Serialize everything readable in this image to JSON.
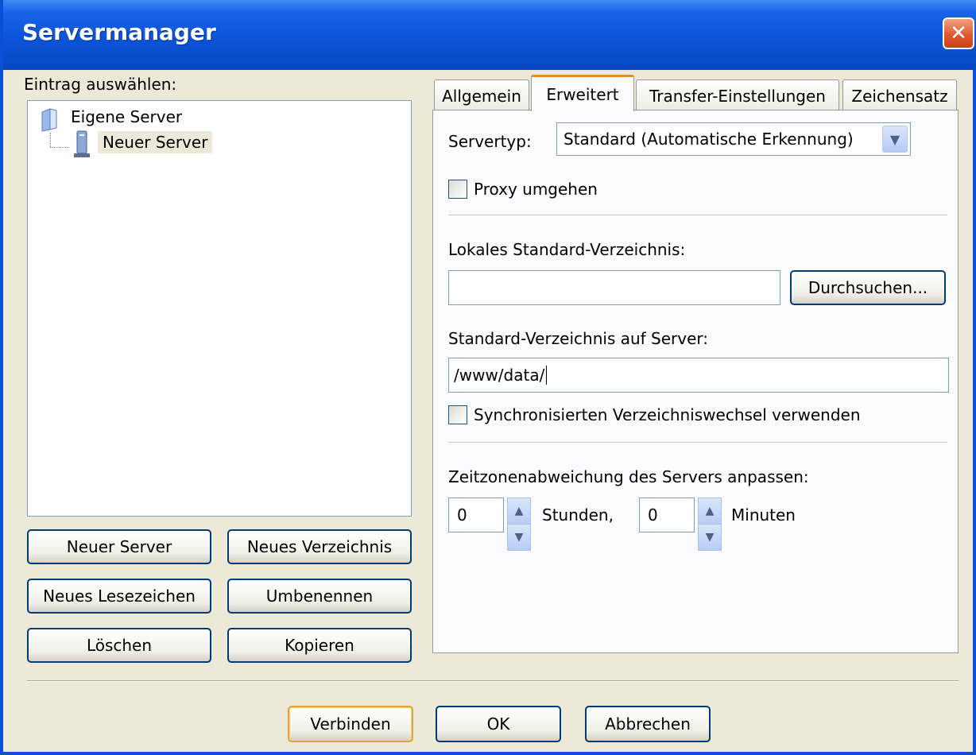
{
  "window": {
    "title": "Servermanager",
    "close_glyph": "✕"
  },
  "tree": {
    "label": "Eintrag auswählen:",
    "root": {
      "label": "Eigene Server",
      "icon": "folder-icon"
    },
    "child": {
      "label": "Neuer Server",
      "icon": "server-icon"
    }
  },
  "left_buttons": {
    "new_server": "Neuer Server",
    "new_folder": "Neues Verzeichnis",
    "new_bookmark": "Neues Lesezeichen",
    "rename": "Umbenennen",
    "delete": "Löschen",
    "copy": "Kopieren"
  },
  "tabs": [
    {
      "label": "Allgemein"
    },
    {
      "label": "Erweitert"
    },
    {
      "label": "Transfer-Einstellungen"
    },
    {
      "label": "Zeichensatz"
    }
  ],
  "advanced": {
    "servertype_label": "Servertyp:",
    "servertype_value": "Standard (Automatische Erkennung)",
    "bypass_proxy_label": "Proxy umgehen",
    "bypass_proxy_checked": false,
    "local_dir_label": "Lokales Standard-Verzeichnis:",
    "local_dir_value": "",
    "browse_label": "Durchsuchen...",
    "remote_dir_label": "Standard-Verzeichnis auf Server:",
    "remote_dir_value": "/www/data/",
    "sync_browsing_label": "Synchronisierten Verzeichniswechsel verwenden",
    "sync_browsing_checked": false,
    "timezone_label": "Zeitzonenabweichung des Servers anpassen:",
    "hours_value": "0",
    "hours_label": "Stunden,",
    "minutes_value": "0",
    "minutes_label": "Minuten"
  },
  "footer": {
    "connect": "Verbinden",
    "ok": "OK",
    "cancel": "Abbrechen"
  }
}
